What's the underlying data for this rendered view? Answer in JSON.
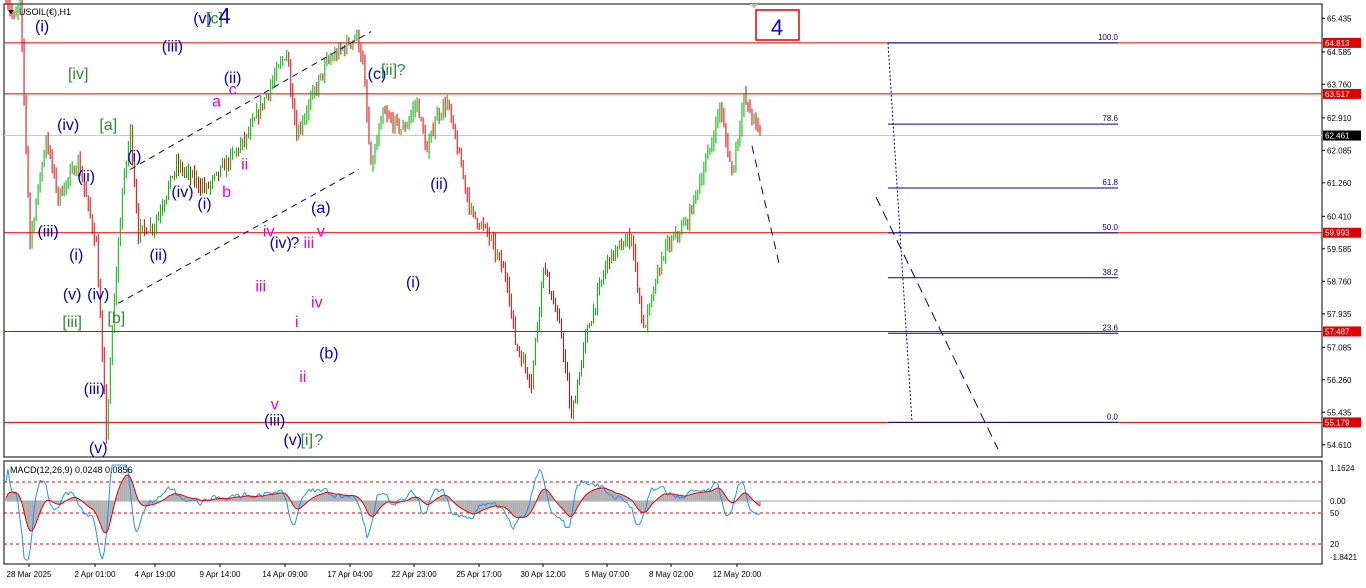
{
  "header": {
    "symbol_title": "USOIL(€),H1",
    "corner_label": "4"
  },
  "chart_data": {
    "type": "line",
    "title": "USOIL(€),H1",
    "price_axis_ticks": [
      65.435,
      64.585,
      63.76,
      62.91,
      62.085,
      61.26,
      60.41,
      59.585,
      58.76,
      57.935,
      57.085,
      56.26,
      55.435,
      54.61
    ],
    "ylim": [
      54.3,
      65.8
    ],
    "horizontal_levels": [
      {
        "value": 64.813,
        "label": "64.813"
      },
      {
        "value": 63.517,
        "label": "63.517"
      },
      {
        "value": 59.993,
        "label": "59.993"
      },
      {
        "value": 57.487,
        "label": "57.487"
      },
      {
        "value": 55.179,
        "label": "55.179"
      }
    ],
    "current_price": {
      "value": 62.461,
      "label": "62.461"
    },
    "fibonacci": [
      {
        "label": "100.0",
        "value": 64.813
      },
      {
        "label": "78.6",
        "value": 62.75
      },
      {
        "label": "61.8",
        "value": 61.13
      },
      {
        "label": "50.0",
        "value": 59.99
      },
      {
        "label": "38.2",
        "value": 58.85
      },
      {
        "label": "23.6",
        "value": 57.44
      },
      {
        "label": "0.0",
        "value": 55.179
      }
    ],
    "price_path": [
      [
        0,
        66.0
      ],
      [
        4,
        65.4
      ],
      [
        7,
        65.8
      ],
      [
        12,
        59.8
      ],
      [
        20,
        62.4
      ],
      [
        26,
        60.9
      ],
      [
        36,
        61.8
      ],
      [
        45,
        59.7
      ],
      [
        50,
        54.9
      ],
      [
        54,
        58.3
      ],
      [
        58,
        61.0
      ],
      [
        62,
        62.6
      ],
      [
        66,
        60.0
      ],
      [
        74,
        60.2
      ],
      [
        85,
        61.7
      ],
      [
        100,
        61.1
      ],
      [
        120,
        62.4
      ],
      [
        140,
        64.6
      ],
      [
        145,
        62.5
      ],
      [
        160,
        64.3
      ],
      [
        175,
        65.0
      ],
      [
        178,
        64.3
      ],
      [
        182,
        61.6
      ],
      [
        188,
        63.0
      ],
      [
        198,
        62.6
      ],
      [
        205,
        63.3
      ],
      [
        210,
        62.0
      ],
      [
        214,
        62.9
      ],
      [
        220,
        63.3
      ],
      [
        232,
        60.5
      ],
      [
        240,
        60.0
      ],
      [
        250,
        58.8
      ],
      [
        254,
        57.2
      ],
      [
        262,
        56.2
      ],
      [
        268,
        59.2
      ],
      [
        277,
        57.4
      ],
      [
        282,
        55.3
      ],
      [
        289,
        57.3
      ],
      [
        300,
        59.3
      ],
      [
        312,
        59.9
      ],
      [
        318,
        57.5
      ],
      [
        328,
        59.5
      ],
      [
        340,
        60.3
      ],
      [
        352,
        62.3
      ],
      [
        356,
        63.2
      ],
      [
        362,
        61.5
      ],
      [
        368,
        63.4
      ],
      [
        376,
        62.5
      ]
    ],
    "x_range": [
      0,
      376
    ],
    "x_tick_labels": [
      "28 Mar 2025",
      "2 Apr 01:00",
      "4 Apr 19:00",
      "9 Apr 14:00",
      "14 Apr 09:00",
      "17 Apr 04:00",
      "22 Apr 23:00",
      "25 Apr 17:00",
      "30 Apr 12:00",
      "5 May 07:00",
      "8 May 02:00",
      "12 May 20:00"
    ],
    "wave_labels": [
      {
        "text": "(i)",
        "x": 18,
        "p": 65.1,
        "color": "#0000cc"
      },
      {
        "text": "[iv]",
        "x": 36,
        "p": 63.9,
        "color": "#2e8b2e"
      },
      {
        "text": "(iv)",
        "x": 31,
        "p": 62.6,
        "color": "#0000cc"
      },
      {
        "text": "[a]",
        "x": 51,
        "p": 62.6,
        "color": "#2e8b2e"
      },
      {
        "text": "(ii)",
        "x": 40,
        "p": 61.3,
        "color": "#0000cc"
      },
      {
        "text": "(iii)",
        "x": 21,
        "p": 59.9,
        "color": "#0000cc"
      },
      {
        "text": "(i)",
        "x": 35,
        "p": 59.3,
        "color": "#0000cc"
      },
      {
        "text": "(v)",
        "x": 33,
        "p": 58.3,
        "color": "#0000cc"
      },
      {
        "text": "(iv)",
        "x": 46,
        "p": 58.3,
        "color": "#0000cc"
      },
      {
        "text": "[iii]",
        "x": 33,
        "p": 57.6,
        "color": "#2e8b2e"
      },
      {
        "text": "[b]",
        "x": 55,
        "p": 57.7,
        "color": "#2e8b2e"
      },
      {
        "text": "(iii)",
        "x": 44,
        "p": 55.9,
        "color": "#0000cc"
      },
      {
        "text": "(v)",
        "x": 46,
        "p": 54.4,
        "color": "#0000cc"
      },
      {
        "text": "(i)",
        "x": 64,
        "p": 61.8,
        "color": "#0000cc"
      },
      {
        "text": "(ii)",
        "x": 76,
        "p": 59.3,
        "color": "#0000cc"
      },
      {
        "text": "(iii)",
        "x": 83,
        "p": 64.6,
        "color": "#0000cc"
      },
      {
        "text": "(iv)",
        "x": 88,
        "p": 60.9,
        "color": "#0000cc"
      },
      {
        "text": "(v)",
        "x": 98,
        "p": 65.3,
        "color": "#0000cc"
      },
      {
        "text": "[c]",
        "x": 104,
        "p": 65.3,
        "color": "#2e8b2e"
      },
      {
        "text": "4",
        "x": 109,
        "p": 65.3,
        "color": "#0000cc"
      },
      {
        "text": "(i)",
        "x": 99,
        "p": 60.6,
        "color": "#0000cc"
      },
      {
        "text": "(ii)",
        "x": 113,
        "p": 63.8,
        "color": "#0000cc"
      },
      {
        "text": "a",
        "x": 105,
        "p": 63.2,
        "color": "#e000e0"
      },
      {
        "text": "c",
        "x": 113,
        "p": 63.5,
        "color": "#e000e0"
      },
      {
        "text": "b",
        "x": 110,
        "p": 60.9,
        "color": "#e000e0"
      },
      {
        "text": "ii",
        "x": 119,
        "p": 61.6,
        "color": "#e000e0"
      },
      {
        "text": "iv",
        "x": 131,
        "p": 59.9,
        "color": "#e000e0"
      },
      {
        "text": "(iv)",
        "x": 137,
        "p": 59.6,
        "color": "#0000cc"
      },
      {
        "text": "?",
        "x": 144,
        "p": 59.6,
        "color": "#0000cc"
      },
      {
        "text": "iii",
        "x": 127,
        "p": 58.5,
        "color": "#e000e0"
      },
      {
        "text": "i",
        "x": 145,
        "p": 57.6,
        "color": "#e000e0"
      },
      {
        "text": "v",
        "x": 134,
        "p": 55.5,
        "color": "#e000e0"
      },
      {
        "text": "(iii)",
        "x": 134,
        "p": 55.1,
        "color": "#0000cc"
      },
      {
        "text": "ii",
        "x": 148,
        "p": 56.2,
        "color": "#e000e0"
      },
      {
        "text": "(v)",
        "x": 143,
        "p": 54.6,
        "color": "#0000cc"
      },
      {
        "text": "[i]",
        "x": 150,
        "p": 54.6,
        "color": "#2e8b2e"
      },
      {
        "text": "?",
        "x": 156,
        "p": 54.6,
        "color": "#2e8b2e"
      },
      {
        "text": "(a)",
        "x": 157,
        "p": 60.5,
        "color": "#0000cc"
      },
      {
        "text": "v",
        "x": 157,
        "p": 59.9,
        "color": "#e000e0"
      },
      {
        "text": "iii",
        "x": 151,
        "p": 59.6,
        "color": "#e000e0"
      },
      {
        "text": "iv",
        "x": 155,
        "p": 58.1,
        "color": "#e000e0"
      },
      {
        "text": "(b)",
        "x": 161,
        "p": 56.8,
        "color": "#0000cc"
      },
      {
        "text": "(c)",
        "x": 185,
        "p": 63.9,
        "color": "#0000cc"
      },
      {
        "text": "[ii]",
        "x": 191,
        "p": 64.0,
        "color": "#2e8b2e"
      },
      {
        "text": "?",
        "x": 197,
        "p": 64.0,
        "color": "#2e8b2e"
      },
      {
        "text": "(ii)",
        "x": 216,
        "p": 61.1,
        "color": "#0000cc"
      },
      {
        "text": "(i)",
        "x": 203,
        "p": 58.6,
        "color": "#0000cc"
      }
    ],
    "macd": {
      "title": "MACD(12,26,9) 0.0248 0.0856",
      "axis_labels": [
        "1.1624",
        "0.00",
        "50",
        "20",
        "-1.8421"
      ]
    }
  }
}
